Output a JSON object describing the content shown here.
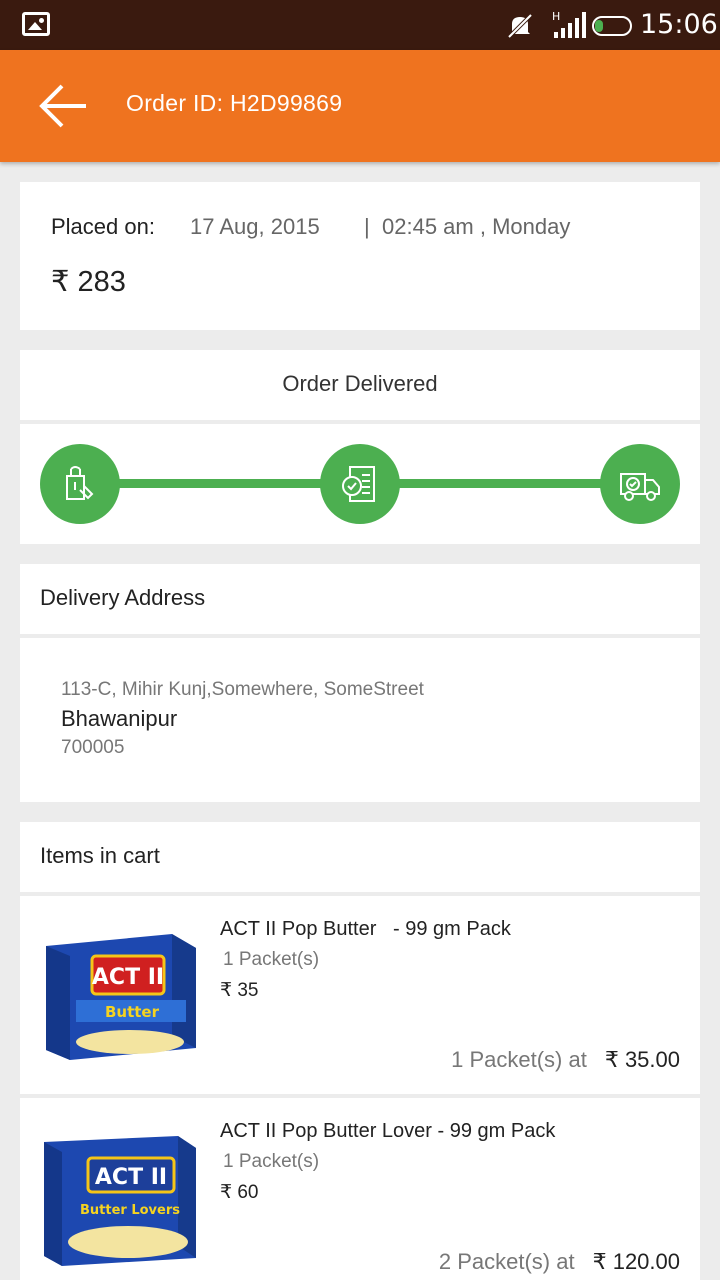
{
  "statusbar": {
    "time": "15:06",
    "network": "H",
    "icons": [
      "gallery-icon",
      "mute-icon",
      "signal-icon",
      "battery-icon"
    ]
  },
  "appbar": {
    "title": "Order ID: H2D99869",
    "back_icon": "arrow-left-icon"
  },
  "order": {
    "placed_label": "Placed on:",
    "date": "17 Aug, 2015",
    "separator": "|",
    "time": "02:45 am , Monday",
    "amount": "₹ 283"
  },
  "status": {
    "text": "Order Delivered",
    "steps": [
      {
        "icon": "shopping-bag-icon"
      },
      {
        "icon": "order-confirmed-icon"
      },
      {
        "icon": "delivery-truck-icon"
      }
    ]
  },
  "address": {
    "heading": "Delivery Address",
    "line1": "113-C, Mihir Kunj,Somewhere, SomeStreet",
    "line2": "Bhawanipur",
    "line3": "700005"
  },
  "cart": {
    "heading": "Items in cart",
    "items": [
      {
        "name": "ACT II Pop Butter   - 99 gm Pack",
        "qty": "1 Packet(s)",
        "price": "₹ 35",
        "summary_qty": "1 Packet(s) at",
        "summary_total": "₹ 35.00",
        "image_text": "ACT II",
        "image_flavor": "Butter"
      },
      {
        "name": "ACT II Pop Butter Lover - 99 gm Pack",
        "qty": "1 Packet(s)",
        "price": "₹ 60",
        "summary_qty": "2 Packet(s) at",
        "summary_total": "₹ 120.00",
        "image_text": "ACT II",
        "image_flavor": "Butter Lovers"
      }
    ]
  },
  "colors": {
    "accent": "#ef731f",
    "status_bar": "#3a1a0f",
    "success": "#4caf50"
  }
}
